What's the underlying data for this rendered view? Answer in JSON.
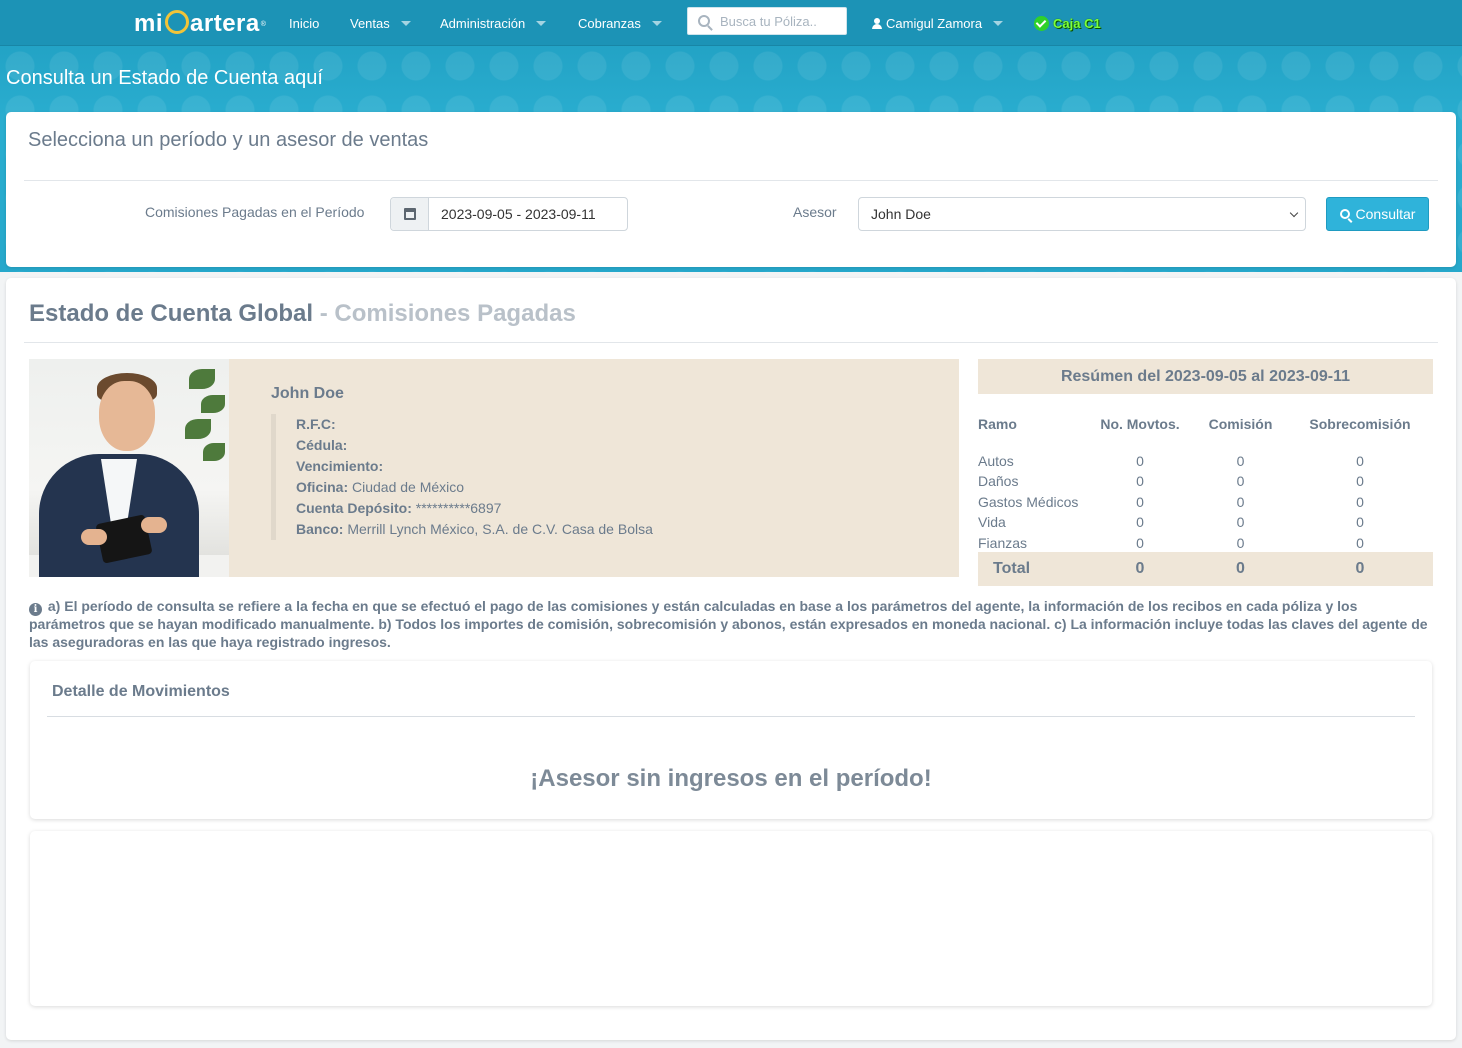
{
  "nav": {
    "logo_prefix": "mi",
    "logo_suffix": "artera",
    "logo_mark": "®",
    "items": [
      {
        "label": "Inicio"
      },
      {
        "label": "Ventas"
      },
      {
        "label": "Administración"
      },
      {
        "label": "Cobranzas"
      }
    ],
    "search_placeholder": "Busca tu Póliza..",
    "user_name": "Camigul Zamora",
    "caja_label": "Caja C1"
  },
  "page_title": "Consulta un Estado de Cuenta aquí",
  "filter": {
    "heading": "Selecciona un período y un asesor de ventas",
    "period_label": "Comisiones Pagadas en el Período",
    "period_value": "2023-09-05 - 2023-09-11",
    "asesor_label": "Asesor",
    "asesor_value": "John Doe",
    "consultar_label": "Consultar"
  },
  "statement": {
    "title": "Estado de Cuenta Global",
    "subtitle": " - Comisiones Pagadas",
    "agent": {
      "name": "John Doe",
      "rfc_label": "R.F.C:",
      "rfc_value": "",
      "cedula_label": "Cédula:",
      "cedula_value": "",
      "vencimiento_label": "Vencimiento:",
      "vencimiento_value": "",
      "oficina_label": "Oficina:",
      "oficina_value": "Ciudad de México",
      "cuenta_label": "Cuenta Depósito:",
      "cuenta_value": "**********6897",
      "banco_label": "Banco:",
      "banco_value": "Merrill Lynch México, S.A. de C.V. Casa de Bolsa"
    },
    "summary": {
      "heading": "Resúmen del 2023-09-05 al 2023-09-11",
      "columns": [
        "Ramo",
        "No. Movtos.",
        "Comisión",
        "Sobrecomisión"
      ],
      "rows": [
        {
          "ramo": "Autos",
          "movtos": "0",
          "comision": "0",
          "sobrecomision": "0"
        },
        {
          "ramo": "Daños",
          "movtos": "0",
          "comision": "0",
          "sobrecomision": "0"
        },
        {
          "ramo": "Gastos Médicos",
          "movtos": "0",
          "comision": "0",
          "sobrecomision": "0"
        },
        {
          "ramo": "Vida",
          "movtos": "0",
          "comision": "0",
          "sobrecomision": "0"
        },
        {
          "ramo": "Fianzas",
          "movtos": "0",
          "comision": "0",
          "sobrecomision": "0"
        }
      ],
      "total": {
        "label": "Total",
        "movtos": "0",
        "comision": "0",
        "sobrecomision": "0"
      }
    },
    "note": "a) El período de consulta se refiere a la fecha en que se efectuó el pago de las comisiones y están calculadas en base a los parámetros del agente, la información de los recibos en cada póliza y los parámetros que se hayan modificado manualmente. b) Todos los importes de comisión, sobrecomisión y abonos, están expresados en moneda nacional. c) La información incluye todas las claves del agente de las aseguradoras en las que haya registrado ingresos.",
    "detail": {
      "heading": "Detalle de Movimientos",
      "empty_message": "¡Asesor sin ingresos en el período!"
    }
  },
  "colors": {
    "header": "#1c93b6",
    "hero": "#2aaed0",
    "primary_button": "#2fb3da",
    "beige_panel": "#efe6d8",
    "text": "#6b7b8c",
    "caja_green": "#7cff3a"
  }
}
